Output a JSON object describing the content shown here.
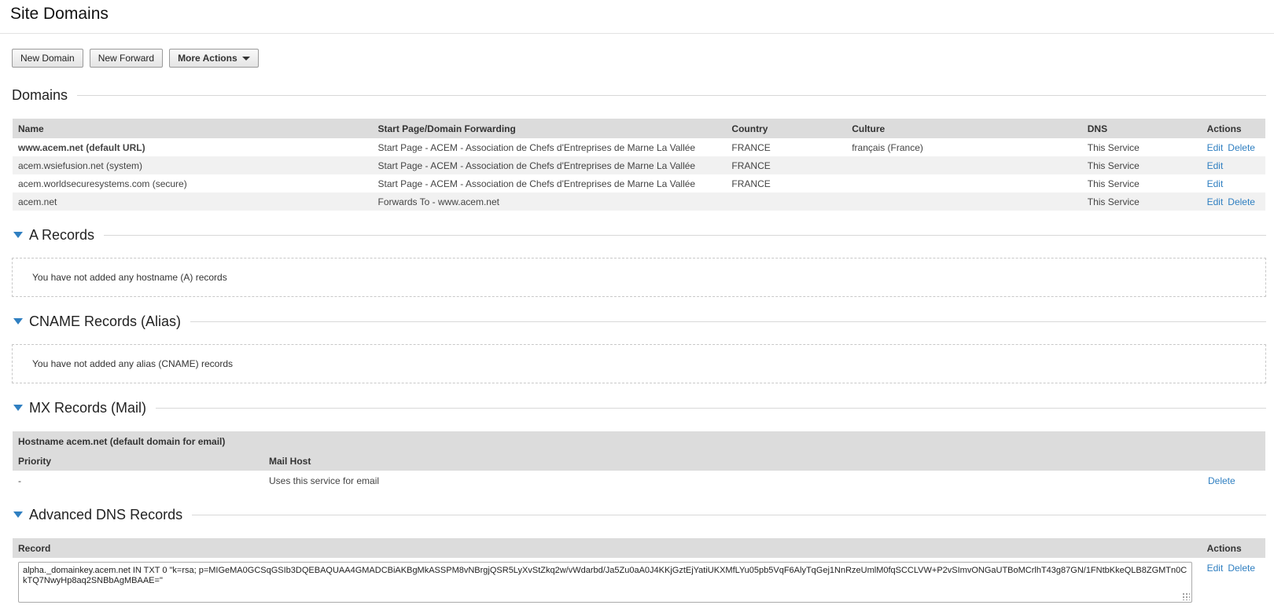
{
  "page": {
    "title": "Site Domains"
  },
  "toolbar": {
    "new_domain": "New Domain",
    "new_forward": "New Forward",
    "more_actions": "More Actions"
  },
  "domains": {
    "title": "Domains",
    "headers": {
      "name": "Name",
      "start_page": "Start Page/Domain Forwarding",
      "country": "Country",
      "culture": "Culture",
      "dns": "DNS",
      "actions": "Actions"
    },
    "rows": [
      {
        "name": "www.acem.net (default URL)",
        "start": "Start Page - ACEM - Association de Chefs d'Entreprises de Marne La Vallée",
        "country": "FRANCE",
        "culture": "français (France)",
        "dns": "This Service",
        "edit": "Edit",
        "delete": "Delete"
      },
      {
        "name": "acem.wsiefusion.net (system)",
        "start": "Start Page - ACEM - Association de Chefs d'Entreprises de Marne La Vallée",
        "country": "FRANCE",
        "culture": "",
        "dns": "This Service",
        "edit": "Edit",
        "delete": ""
      },
      {
        "name": "acem.worldsecuresystems.com (secure)",
        "start": "Start Page - ACEM - Association de Chefs d'Entreprises de Marne La Vallée",
        "country": "FRANCE",
        "culture": "",
        "dns": "This Service",
        "edit": "Edit",
        "delete": ""
      },
      {
        "name": "acem.net",
        "start": "Forwards To - www.acem.net",
        "country": "",
        "culture": "",
        "dns": "This Service",
        "edit": "Edit",
        "delete": "Delete"
      }
    ]
  },
  "a_records": {
    "title": "A Records",
    "empty": "You have not added any hostname (A) records"
  },
  "cname_records": {
    "title": "CNAME Records (Alias)",
    "empty": "You have not added any alias (CNAME) records"
  },
  "mx_records": {
    "title": "MX Records (Mail)",
    "hostname": "Hostname acem.net (default domain for email)",
    "headers": {
      "priority": "Priority",
      "mail_host": "Mail Host"
    },
    "rows": [
      {
        "priority": "-",
        "mail_host": "Uses this service for email",
        "delete": "Delete"
      }
    ]
  },
  "advanced_dns": {
    "title": "Advanced DNS Records",
    "headers": {
      "record": "Record",
      "actions": "Actions"
    },
    "record": "alpha._domainkey.acem.net IN TXT 0 \"k=rsa; p=MIGeMA0GCSqGSIb3DQEBAQUAA4GMADCBiAKBgMkASSPM8vNBrgjQSR5LyXvStZkq2w/vWdarbd/Ja5Zu0aA0J4KKjGztEjYatiUKXMfLYu05pb5VqF6AlyTqGej1NnRzeUmlM0fqSCCLVW+P2vSImvONGaUTBoMCrlhT43g87GN/1FNtbKkeQLB8ZGMTn0CkTQ7NwyHp8aq2SNBbAgMBAAE=\"",
    "edit": "Edit",
    "delete": "Delete"
  },
  "colors": {
    "accent": "#2f7fc1",
    "header_bg": "#dcdcdc",
    "row_alt": "#f1f1f1"
  }
}
